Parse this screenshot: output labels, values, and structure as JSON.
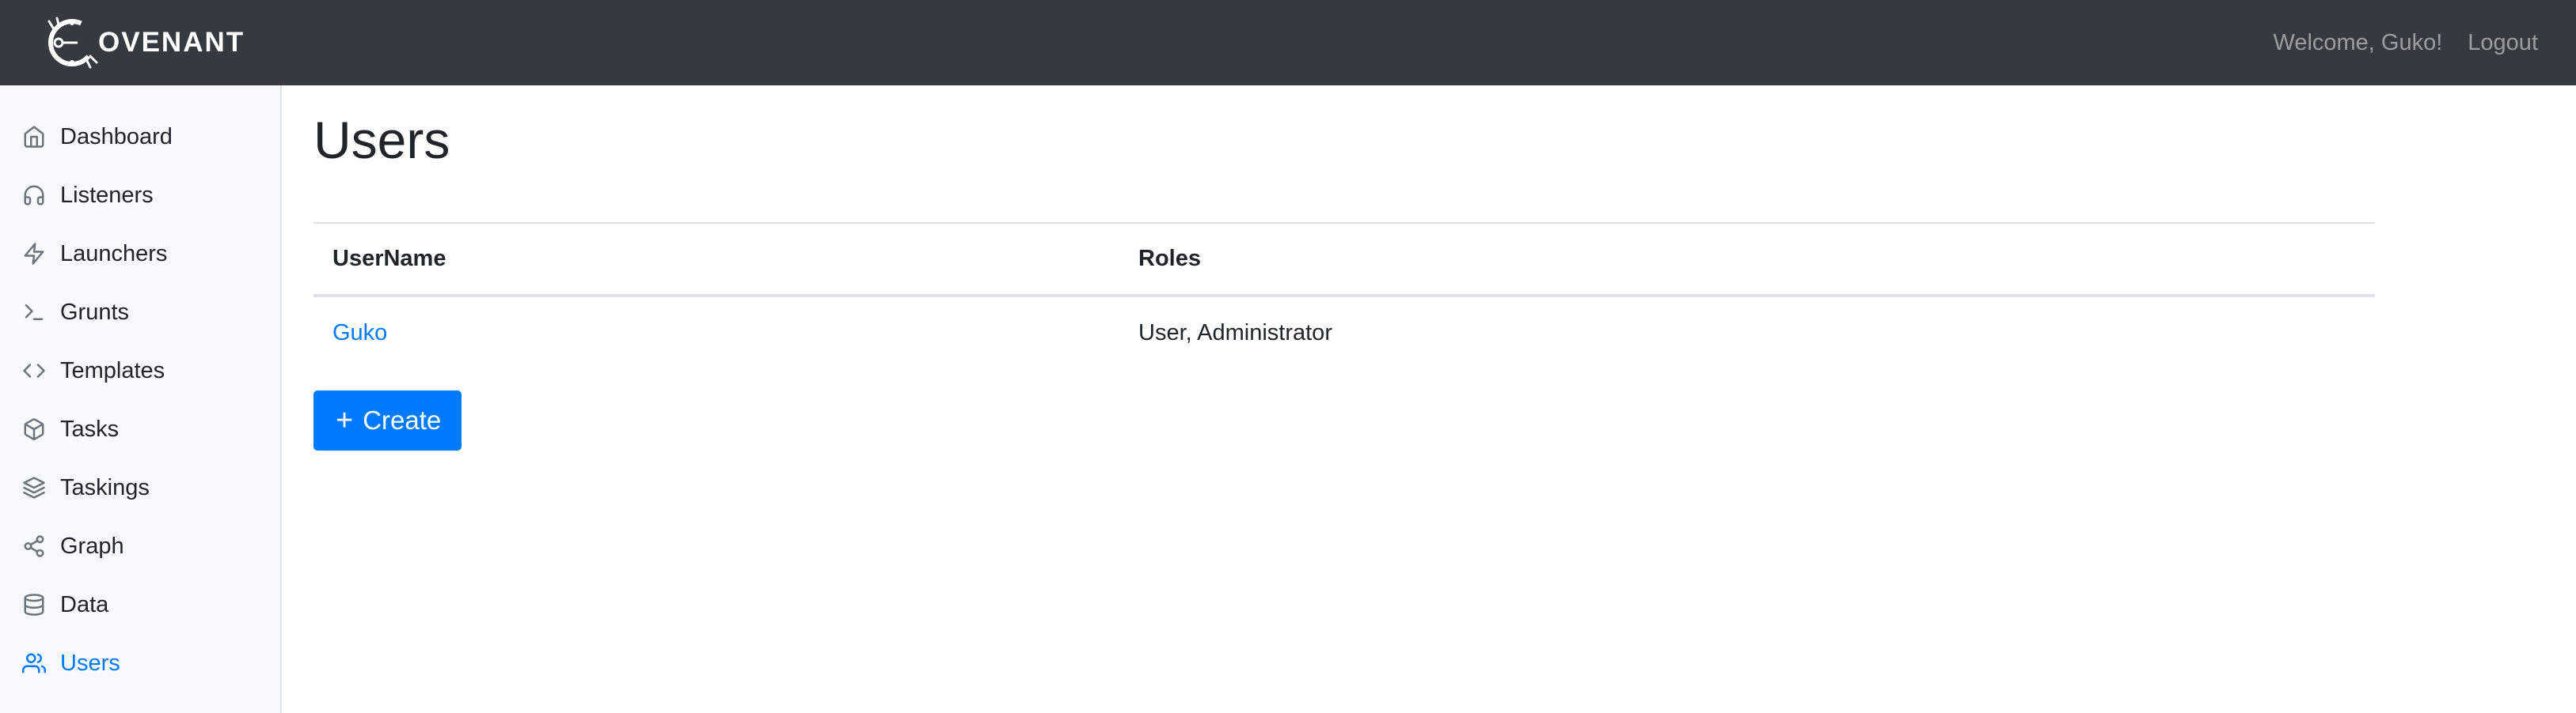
{
  "app": {
    "brand_text": "OVENANT",
    "logo_icon": "covenant-logo-icon"
  },
  "header": {
    "welcome_text": "Welcome, Guko!",
    "logout_label": "Logout"
  },
  "sidebar": {
    "items": [
      {
        "label": "Dashboard",
        "icon": "home-icon",
        "active": false
      },
      {
        "label": "Listeners",
        "icon": "headphones-icon",
        "active": false
      },
      {
        "label": "Launchers",
        "icon": "zap-icon",
        "active": false
      },
      {
        "label": "Grunts",
        "icon": "terminal-icon",
        "active": false
      },
      {
        "label": "Templates",
        "icon": "code-icon",
        "active": false
      },
      {
        "label": "Tasks",
        "icon": "package-icon",
        "active": false
      },
      {
        "label": "Taskings",
        "icon": "layers-icon",
        "active": false
      },
      {
        "label": "Graph",
        "icon": "share-icon",
        "active": false
      },
      {
        "label": "Data",
        "icon": "database-icon",
        "active": false
      },
      {
        "label": "Users",
        "icon": "users-icon",
        "active": true
      }
    ]
  },
  "main": {
    "title": "Users",
    "table": {
      "columns": [
        "UserName",
        "Roles"
      ],
      "rows": [
        {
          "username": "Guko",
          "roles": "User, Administrator"
        }
      ]
    },
    "create_button_label": "Create"
  },
  "colors": {
    "navbar_bg": "#343a40",
    "accent": "#007bff",
    "sidebar_bg": "#f8f9fa"
  }
}
